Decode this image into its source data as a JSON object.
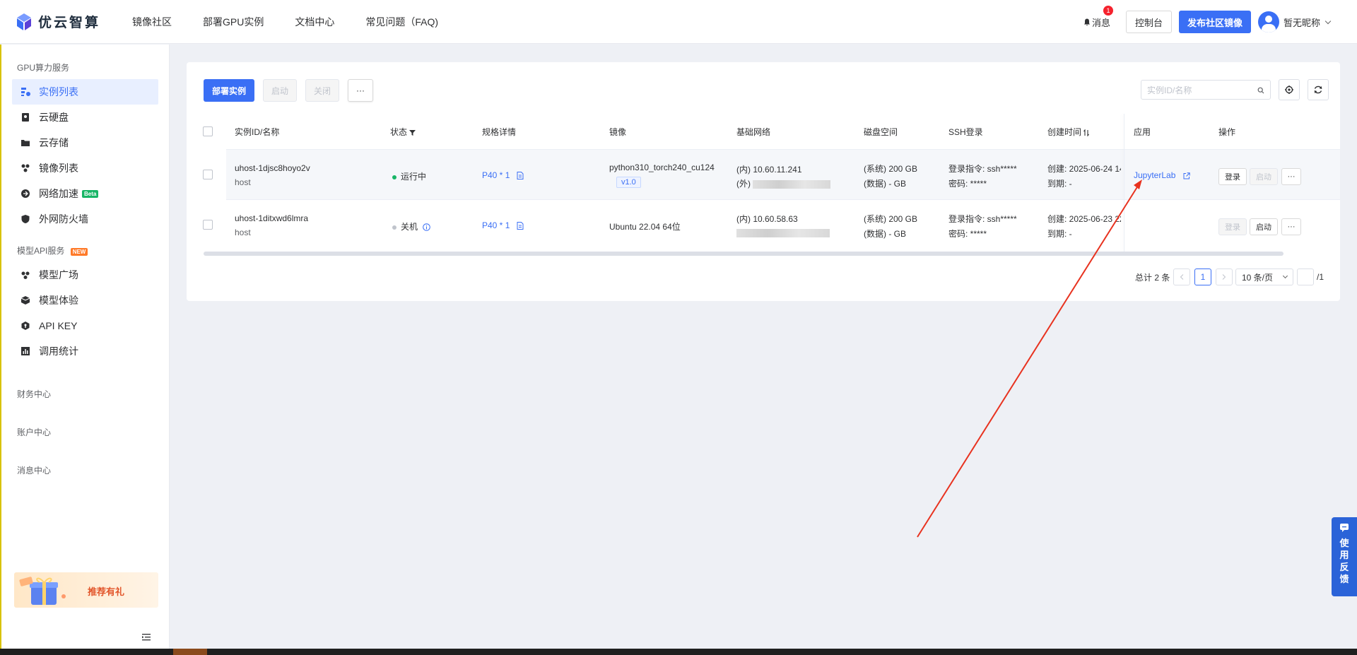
{
  "brand": {
    "name": "优云智算"
  },
  "nav": {
    "links": [
      "镜像社区",
      "部署GPU实例",
      "文档中心",
      "常见问题（FAQ)"
    ]
  },
  "topRight": {
    "messages_label": "消息",
    "message_count": "1",
    "console_label": "控制台",
    "publish_label": "发布社区镜像",
    "user_name": "暂无昵称"
  },
  "sidebar": {
    "section_gpu": "GPU算力服务",
    "gpu_items": [
      "实例列表",
      "云硬盘",
      "云存储",
      "镜像列表",
      "网络加速",
      "外网防火墙"
    ],
    "beta_label": "Beta",
    "section_model": "模型API服务",
    "new_label": "NEW",
    "model_items": [
      "模型广场",
      "模型体验",
      "API KEY",
      "调用统计"
    ],
    "finance": "财务中心",
    "account": "账户中心",
    "message_center": "消息中心",
    "promo_text": "推荐有礼"
  },
  "toolbar": {
    "deploy": "部署实例",
    "start": "启动",
    "stop": "关闭",
    "more": "···",
    "search_placeholder": "实例ID/名称"
  },
  "table": {
    "headers": [
      "实例ID/名称",
      "状态",
      "规格详情",
      "镜像",
      "基础网络",
      "磁盘空间",
      "SSH登录",
      "创建时间",
      "应用",
      "操作"
    ],
    "rows": [
      {
        "id": "uhost-1djsc8hoyo2v",
        "name": "host",
        "status": "运行中",
        "spec": "P40 * 1",
        "image": "python310_torch240_cu124",
        "image_tag": "v1.0",
        "net_in": "(内) 10.60.11.241",
        "net_out": "(外)",
        "disk_sys": "(系统) 200 GB",
        "disk_data": "(数据) - GB",
        "ssh_cmd": "登录指令:  ssh*****",
        "ssh_pwd": "密码:  *****",
        "created": "创建: 2025-06-24 14",
        "expire": "到期: -",
        "app": "JupyterLab",
        "login": "登录",
        "start": "启动",
        "more": "···"
      },
      {
        "id": "uhost-1ditxwd6lmra",
        "name": "host",
        "status": "关机",
        "spec": "P40 * 1",
        "image": "Ubuntu 22.04 64位",
        "image_tag": "",
        "net_in": "(内) 10.60.58.63",
        "net_out": "",
        "disk_sys": "(系统) 200 GB",
        "disk_data": "(数据) - GB",
        "ssh_cmd": "登录指令:  ssh*****",
        "ssh_pwd": "密码:  *****",
        "created": "创建: 2025-06-23 22",
        "expire": "到期: -",
        "app": "",
        "login": "登录",
        "start": "启动",
        "more": "···"
      }
    ]
  },
  "pagination": {
    "total": "总计 2 条",
    "current": "1",
    "page_size": "10 条/页",
    "total_pages": "/1"
  },
  "feedback": {
    "chars": [
      "使",
      "用",
      "反",
      "馈"
    ]
  },
  "colors": {
    "primary": "#3a6ff5",
    "running": "#18b566",
    "stopped": "#c0c4cc",
    "annotation_arrow": "#e8321f"
  }
}
